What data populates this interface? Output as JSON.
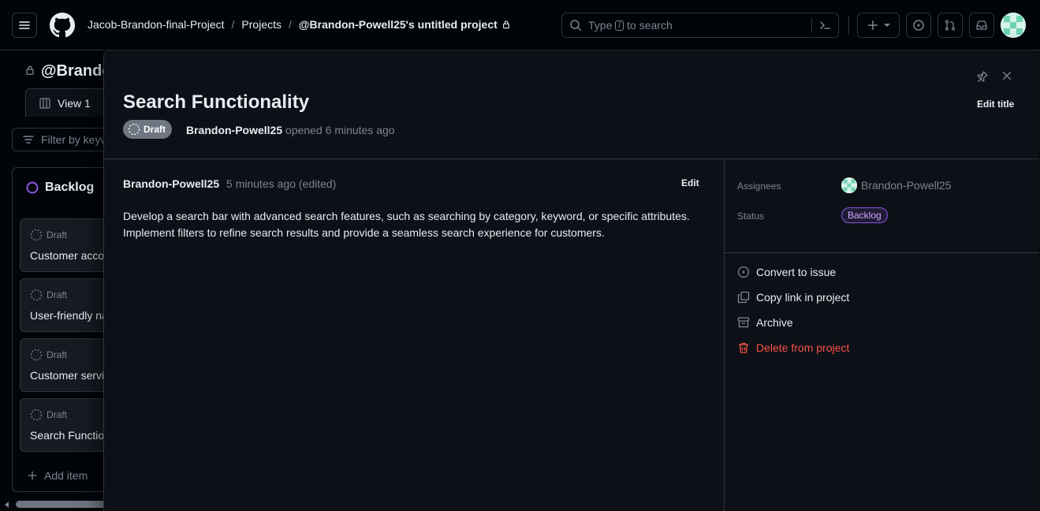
{
  "header": {
    "breadcrumbs": [
      "Jacob-Brandon-final-Project",
      "Projects",
      "@Brandon-Powell25's untitled project"
    ],
    "search_placeholder_pre": "Type",
    "search_key": "/",
    "search_placeholder_post": "to search"
  },
  "board": {
    "title": "@Brando",
    "view_tab": "View 1",
    "filter_placeholder": "Filter by keyw",
    "column_name": "Backlog",
    "cards": [
      {
        "status": "Draft",
        "title": "Customer accou"
      },
      {
        "status": "Draft",
        "title": "User-friendly na"
      },
      {
        "status": "Draft",
        "title": "Customer servic"
      },
      {
        "status": "Draft",
        "title": "Search Functior"
      }
    ],
    "add_item": "Add item"
  },
  "panel": {
    "title": "Search Functionality",
    "edit_title": "Edit title",
    "state_badge": "Draft",
    "author": "Brandon-Powell25",
    "opened_text": "opened 6 minutes ago",
    "comment": {
      "author": "Brandon-Powell25",
      "time": "5 minutes ago (edited)",
      "edit_label": "Edit",
      "body_line1": "Develop a search bar with advanced search features, such as searching by category, keyword, or specific attributes.",
      "body_line2": "Implement filters to refine search results and provide a seamless search experience for customers."
    },
    "sidebar": {
      "assignees_label": "Assignees",
      "assignee": "Brandon-Powell25",
      "status_label": "Status",
      "status_value": "Backlog"
    },
    "actions": {
      "convert": "Convert to issue",
      "copy_link": "Copy link in project",
      "archive": "Archive",
      "delete": "Delete from project"
    }
  },
  "colors": {
    "accent_purple": "#8957e5",
    "danger": "#f85149",
    "bg": "#0d1117"
  }
}
